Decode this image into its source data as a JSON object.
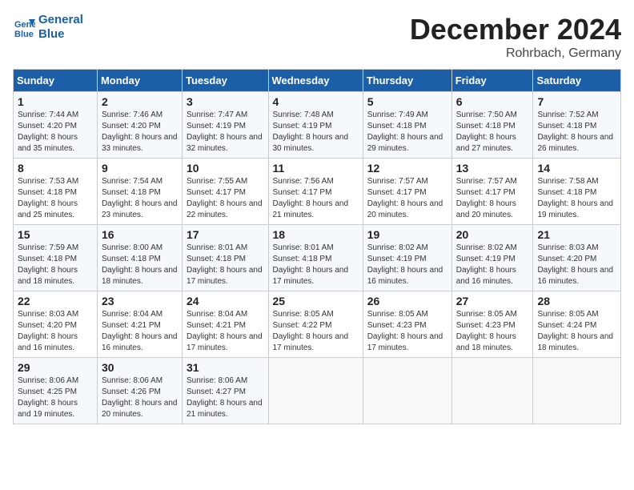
{
  "logo": {
    "line1": "General",
    "line2": "Blue"
  },
  "title": "December 2024",
  "subtitle": "Rohrbach, Germany",
  "headers": [
    "Sunday",
    "Monday",
    "Tuesday",
    "Wednesday",
    "Thursday",
    "Friday",
    "Saturday"
  ],
  "weeks": [
    [
      {
        "day": "1",
        "sunrise": "Sunrise: 7:44 AM",
        "sunset": "Sunset: 4:20 PM",
        "daylight": "Daylight: 8 hours and 35 minutes."
      },
      {
        "day": "2",
        "sunrise": "Sunrise: 7:46 AM",
        "sunset": "Sunset: 4:20 PM",
        "daylight": "Daylight: 8 hours and 33 minutes."
      },
      {
        "day": "3",
        "sunrise": "Sunrise: 7:47 AM",
        "sunset": "Sunset: 4:19 PM",
        "daylight": "Daylight: 8 hours and 32 minutes."
      },
      {
        "day": "4",
        "sunrise": "Sunrise: 7:48 AM",
        "sunset": "Sunset: 4:19 PM",
        "daylight": "Daylight: 8 hours and 30 minutes."
      },
      {
        "day": "5",
        "sunrise": "Sunrise: 7:49 AM",
        "sunset": "Sunset: 4:18 PM",
        "daylight": "Daylight: 8 hours and 29 minutes."
      },
      {
        "day": "6",
        "sunrise": "Sunrise: 7:50 AM",
        "sunset": "Sunset: 4:18 PM",
        "daylight": "Daylight: 8 hours and 27 minutes."
      },
      {
        "day": "7",
        "sunrise": "Sunrise: 7:52 AM",
        "sunset": "Sunset: 4:18 PM",
        "daylight": "Daylight: 8 hours and 26 minutes."
      }
    ],
    [
      {
        "day": "8",
        "sunrise": "Sunrise: 7:53 AM",
        "sunset": "Sunset: 4:18 PM",
        "daylight": "Daylight: 8 hours and 25 minutes."
      },
      {
        "day": "9",
        "sunrise": "Sunrise: 7:54 AM",
        "sunset": "Sunset: 4:18 PM",
        "daylight": "Daylight: 8 hours and 23 minutes."
      },
      {
        "day": "10",
        "sunrise": "Sunrise: 7:55 AM",
        "sunset": "Sunset: 4:17 PM",
        "daylight": "Daylight: 8 hours and 22 minutes."
      },
      {
        "day": "11",
        "sunrise": "Sunrise: 7:56 AM",
        "sunset": "Sunset: 4:17 PM",
        "daylight": "Daylight: 8 hours and 21 minutes."
      },
      {
        "day": "12",
        "sunrise": "Sunrise: 7:57 AM",
        "sunset": "Sunset: 4:17 PM",
        "daylight": "Daylight: 8 hours and 20 minutes."
      },
      {
        "day": "13",
        "sunrise": "Sunrise: 7:57 AM",
        "sunset": "Sunset: 4:17 PM",
        "daylight": "Daylight: 8 hours and 20 minutes."
      },
      {
        "day": "14",
        "sunrise": "Sunrise: 7:58 AM",
        "sunset": "Sunset: 4:18 PM",
        "daylight": "Daylight: 8 hours and 19 minutes."
      }
    ],
    [
      {
        "day": "15",
        "sunrise": "Sunrise: 7:59 AM",
        "sunset": "Sunset: 4:18 PM",
        "daylight": "Daylight: 8 hours and 18 minutes."
      },
      {
        "day": "16",
        "sunrise": "Sunrise: 8:00 AM",
        "sunset": "Sunset: 4:18 PM",
        "daylight": "Daylight: 8 hours and 18 minutes."
      },
      {
        "day": "17",
        "sunrise": "Sunrise: 8:01 AM",
        "sunset": "Sunset: 4:18 PM",
        "daylight": "Daylight: 8 hours and 17 minutes."
      },
      {
        "day": "18",
        "sunrise": "Sunrise: 8:01 AM",
        "sunset": "Sunset: 4:18 PM",
        "daylight": "Daylight: 8 hours and 17 minutes."
      },
      {
        "day": "19",
        "sunrise": "Sunrise: 8:02 AM",
        "sunset": "Sunset: 4:19 PM",
        "daylight": "Daylight: 8 hours and 16 minutes."
      },
      {
        "day": "20",
        "sunrise": "Sunrise: 8:02 AM",
        "sunset": "Sunset: 4:19 PM",
        "daylight": "Daylight: 8 hours and 16 minutes."
      },
      {
        "day": "21",
        "sunrise": "Sunrise: 8:03 AM",
        "sunset": "Sunset: 4:20 PM",
        "daylight": "Daylight: 8 hours and 16 minutes."
      }
    ],
    [
      {
        "day": "22",
        "sunrise": "Sunrise: 8:03 AM",
        "sunset": "Sunset: 4:20 PM",
        "daylight": "Daylight: 8 hours and 16 minutes."
      },
      {
        "day": "23",
        "sunrise": "Sunrise: 8:04 AM",
        "sunset": "Sunset: 4:21 PM",
        "daylight": "Daylight: 8 hours and 16 minutes."
      },
      {
        "day": "24",
        "sunrise": "Sunrise: 8:04 AM",
        "sunset": "Sunset: 4:21 PM",
        "daylight": "Daylight: 8 hours and 17 minutes."
      },
      {
        "day": "25",
        "sunrise": "Sunrise: 8:05 AM",
        "sunset": "Sunset: 4:22 PM",
        "daylight": "Daylight: 8 hours and 17 minutes."
      },
      {
        "day": "26",
        "sunrise": "Sunrise: 8:05 AM",
        "sunset": "Sunset: 4:23 PM",
        "daylight": "Daylight: 8 hours and 17 minutes."
      },
      {
        "day": "27",
        "sunrise": "Sunrise: 8:05 AM",
        "sunset": "Sunset: 4:23 PM",
        "daylight": "Daylight: 8 hours and 18 minutes."
      },
      {
        "day": "28",
        "sunrise": "Sunrise: 8:05 AM",
        "sunset": "Sunset: 4:24 PM",
        "daylight": "Daylight: 8 hours and 18 minutes."
      }
    ],
    [
      {
        "day": "29",
        "sunrise": "Sunrise: 8:06 AM",
        "sunset": "Sunset: 4:25 PM",
        "daylight": "Daylight: 8 hours and 19 minutes."
      },
      {
        "day": "30",
        "sunrise": "Sunrise: 8:06 AM",
        "sunset": "Sunset: 4:26 PM",
        "daylight": "Daylight: 8 hours and 20 minutes."
      },
      {
        "day": "31",
        "sunrise": "Sunrise: 8:06 AM",
        "sunset": "Sunset: 4:27 PM",
        "daylight": "Daylight: 8 hours and 21 minutes."
      },
      null,
      null,
      null,
      null
    ]
  ]
}
